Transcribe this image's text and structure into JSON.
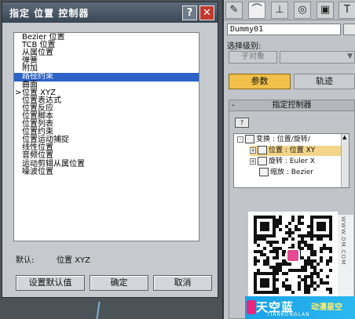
{
  "dialog": {
    "title": "指定 位置 控制器",
    "help": "?",
    "close": "✕",
    "list": [
      "Bezier 位置",
      "TCB 位置",
      "从属位置",
      "弹簧",
      "附加",
      "路径约束",
      "曲面",
      "位置 XYZ",
      "位置表达式",
      "位置反应",
      "位置脚本",
      "位置列表",
      "位置约束",
      "位置运动捕捉",
      "线性位置",
      "音频位置",
      "运动剪辑从属位置",
      "噪波位置"
    ],
    "selected_index": 5,
    "current_index": 7,
    "default_label": "默认:",
    "default_value": "位置 XYZ",
    "buttons": {
      "set_default": "设置默认值",
      "ok": "确定",
      "cancel": "取消"
    }
  },
  "panel": {
    "object_name": "Dummy01",
    "selection_level_label": "选择级别:",
    "subobject_button": "子对象",
    "tabs": {
      "params": "参数",
      "track": "轨迹"
    },
    "rollout_title": "指定控制器",
    "rollout_toggle": "-",
    "tree": [
      {
        "label": "变换 : 位置/旋转/",
        "exp": "-"
      },
      {
        "label": "位置 : 位置 XY",
        "exp": "+"
      },
      {
        "label": "旋转 : Euler X",
        "exp": "+"
      },
      {
        "label": "缩放 : Bezier",
        "exp": ""
      }
    ]
  },
  "watermark": {
    "main": "天空蓝",
    "sub": "动漫星空",
    "pinyin": "TIANKONGLAN",
    "side": "WWW.DM.COM"
  }
}
